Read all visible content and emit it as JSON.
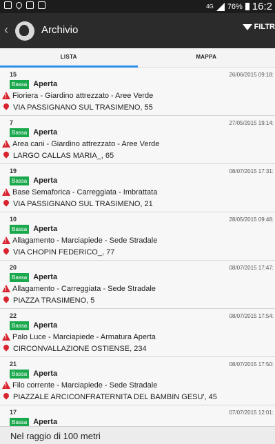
{
  "status_bar": {
    "network": "4G",
    "battery": "76%",
    "time": "16:2"
  },
  "header": {
    "title": "Archivio",
    "filter_label": "FILTR"
  },
  "tabs": [
    {
      "label": "LISTA",
      "active": true
    },
    {
      "label": "MAPPA",
      "active": false
    }
  ],
  "items": [
    {
      "id": "15",
      "date": "26/06/2015 09:18:",
      "priority": "Bassa",
      "status": "Aperta",
      "category": "Fioriera - Giardino attrezzato - Aree Verde",
      "address": "VIA PASSIGNANO SUL TRASIMENO, 55"
    },
    {
      "id": "7",
      "date": "27/05/2015 19:14:",
      "priority": "Bassa",
      "status": "Aperta",
      "category": "Area cani - Giardino attrezzato - Aree Verde",
      "address": "LARGO CALLAS MARIA_, 65"
    },
    {
      "id": "19",
      "date": "08/07/2015 17:31:",
      "priority": "Bassa",
      "status": "Aperta",
      "category": "Base Semaforica - Carreggiata - Imbrattata",
      "address": "VIA PASSIGNANO SUL TRASIMENO, 21"
    },
    {
      "id": "10",
      "date": "28/05/2015 09:48:",
      "priority": "Bassa",
      "status": "Aperta",
      "category": "Allagamento - Marciapiede - Sede Stradale",
      "address": "VIA CHOPIN FEDERICO_, 77"
    },
    {
      "id": "20",
      "date": "08/07/2015 17:47:",
      "priority": "Bassa",
      "status": "Aperta",
      "category": "Allagamento - Carreggiata - Sede Stradale",
      "address": "PIAZZA TRASIMENO, 5"
    },
    {
      "id": "22",
      "date": "08/07/2015 17:54:",
      "priority": "Bassa",
      "status": "Aperta",
      "category": "Palo Luce - Marciapiede - Armatura Aperta",
      "address": "CIRCONVALLAZIONE OSTIENSE, 234"
    },
    {
      "id": "21",
      "date": "08/07/2015 17:50:",
      "priority": "Bassa",
      "status": "Aperta",
      "category": "Filo corrente - Marciapiede - Sede Stradale",
      "address": "PIAZZALE ARCICONFRATERNITA DEL BAMBIN GESU', 45"
    },
    {
      "id": "17",
      "date": "07/07/2015 12:01:",
      "priority": "Bassa",
      "status": "Aperta",
      "category": "",
      "address": ""
    }
  ],
  "footer": {
    "text": "Nel raggio di 100 metri"
  }
}
